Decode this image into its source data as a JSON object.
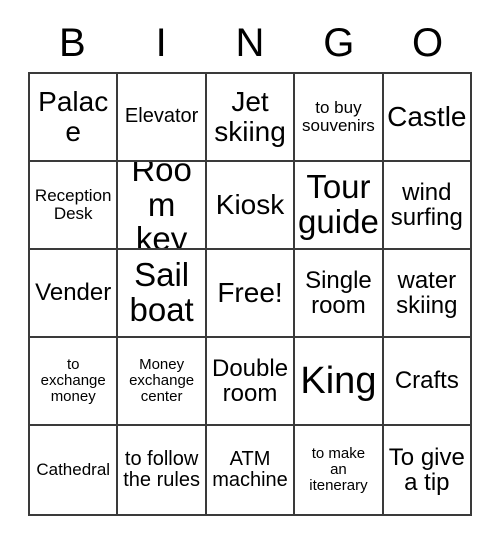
{
  "card": {
    "title": "BINGO",
    "headers": [
      "B",
      "I",
      "N",
      "G",
      "O"
    ],
    "free_space_label": "Free!",
    "rows": [
      [
        {
          "text": "Palace",
          "size": "lg"
        },
        {
          "text": "Elevator",
          "size": "sm"
        },
        {
          "text": "Jet\nskiing",
          "size": "lg"
        },
        {
          "text": "to buy\nsouvenirs",
          "size": "xs"
        },
        {
          "text": "Castle",
          "size": "lg"
        }
      ],
      [
        {
          "text": "Reception\nDesk",
          "size": "xs"
        },
        {
          "text": "Room\nkey",
          "size": "xl"
        },
        {
          "text": "Kiosk",
          "size": "lg"
        },
        {
          "text": "Tour\nguide",
          "size": "xl"
        },
        {
          "text": "wind\nsurfing",
          "size": "md"
        }
      ],
      [
        {
          "text": "Vender",
          "size": "md"
        },
        {
          "text": "Sail\nboat",
          "size": "xl"
        },
        {
          "text": "Free!",
          "size": "lg"
        },
        {
          "text": "Single\nroom",
          "size": "md"
        },
        {
          "text": "water\nskiing",
          "size": "md"
        }
      ],
      [
        {
          "text": "to\nexchange\nmoney",
          "size": "xxs"
        },
        {
          "text": "Money\nexchange\ncenter",
          "size": "xxs"
        },
        {
          "text": "Double\nroom",
          "size": "md"
        },
        {
          "text": "King",
          "size": "xxl"
        },
        {
          "text": "Crafts",
          "size": "md"
        }
      ],
      [
        {
          "text": "Cathedral",
          "size": "xs"
        },
        {
          "text": "to follow\nthe rules",
          "size": "sm"
        },
        {
          "text": "ATM\nmachine",
          "size": "sm"
        },
        {
          "text": "to make\nan\nitenerary",
          "size": "xxs"
        },
        {
          "text": "To give\na tip",
          "size": "md"
        }
      ]
    ]
  },
  "colors": {
    "border": "#3a3a3a",
    "text": "#000000",
    "background": "#ffffff"
  }
}
